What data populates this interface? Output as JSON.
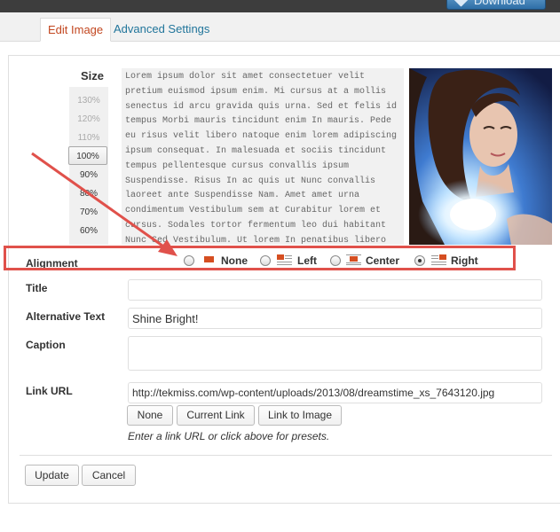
{
  "toolbar": {
    "download_label": "Download"
  },
  "tabs": [
    {
      "label": "Edit Image",
      "active": true
    },
    {
      "label": "Advanced Settings",
      "active": false
    }
  ],
  "size": {
    "label": "Size",
    "options": [
      "130%",
      "120%",
      "110%",
      "100%",
      "90%",
      "80%",
      "70%",
      "60%"
    ],
    "selected": "100%"
  },
  "preview": {
    "text": "Lorem ipsum dolor sit amet consectetuer velit pretium euismod ipsum enim. Mi cursus at a mollis senectus id arcu gravida quis urna. Sed et felis id tempus Morbi mauris tincidunt enim In mauris. Pede eu risus velit libero natoque enim lorem adipiscing ipsum consequat. In malesuada et sociis tincidunt tempus pellentesque cursus convallis ipsum Suspendisse. Risus In ac quis ut Nunc convallis laoreet ante Suspendisse Nam. Amet amet urna condimentum Vestibulum sem at Curabitur lorem et cursus. Sodales tortor fermentum leo dui habitant Nunc Sed Vestibulum. Ut lorem In penatibus libero id ipsum sagittis nec elit Sed. Condimentum eget."
  },
  "alignment": {
    "label": "Alignment",
    "options": [
      {
        "label": "None",
        "checked": false
      },
      {
        "label": "Left",
        "checked": false
      },
      {
        "label": "Center",
        "checked": false
      },
      {
        "label": "Right",
        "checked": true
      }
    ]
  },
  "fields": {
    "title": {
      "label": "Title",
      "value": ""
    },
    "alt_text": {
      "label": "Alternative Text",
      "value": "Shine Bright!"
    },
    "caption": {
      "label": "Caption",
      "value": ""
    },
    "link_url": {
      "label": "Link URL",
      "value": "http://tekmiss.com/wp-content/uploads/2013/08/dreamstime_xs_7643120.jpg"
    }
  },
  "link_buttons": {
    "none": "None",
    "current": "Current Link",
    "image": "Link to Image"
  },
  "hint": "Enter a link URL or click above for presets.",
  "footer": {
    "update": "Update",
    "cancel": "Cancel"
  },
  "colors": {
    "accent": "#21759b",
    "active_tab": "#c2461f",
    "annotation": "#e0514b",
    "icon_red": "#d54e21"
  },
  "icons": [
    "download-icon",
    "align-none-icon",
    "align-left-icon",
    "align-center-icon",
    "align-right-icon"
  ]
}
